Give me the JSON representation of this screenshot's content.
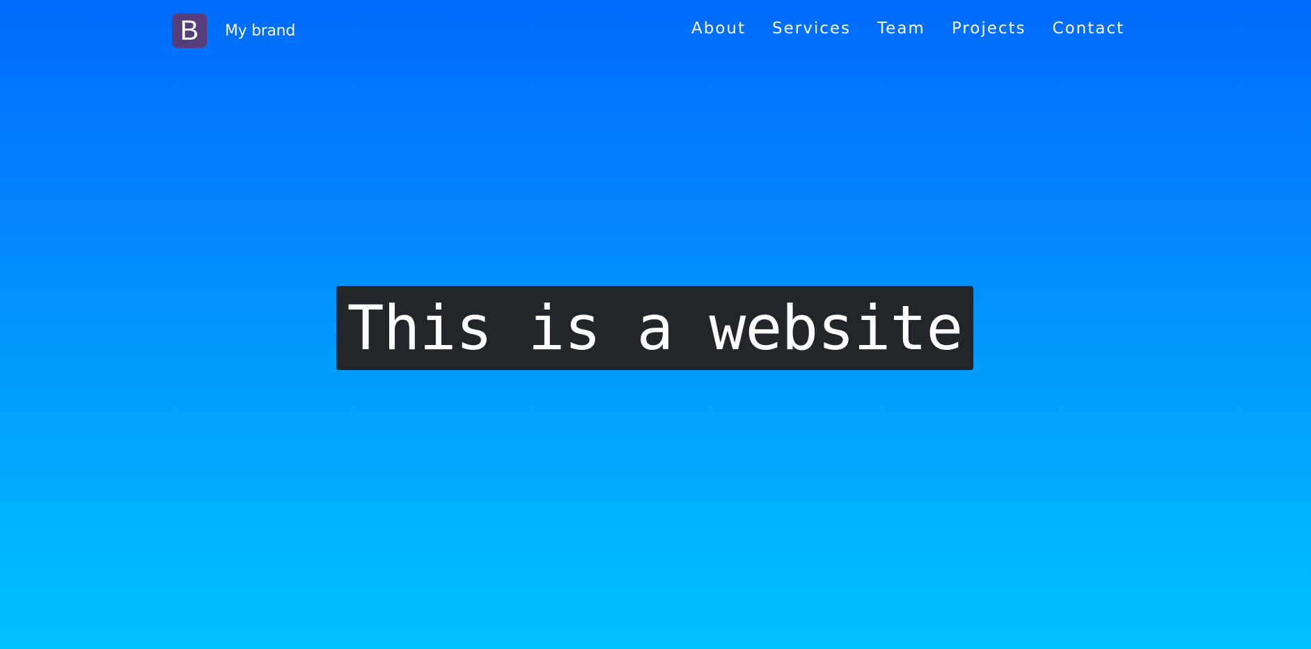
{
  "brand": {
    "logo_letter": "B",
    "name": "My brand"
  },
  "nav": {
    "items": [
      {
        "label": "About"
      },
      {
        "label": "Services"
      },
      {
        "label": "Team"
      },
      {
        "label": "Projects"
      },
      {
        "label": "Contact"
      }
    ]
  },
  "hero": {
    "title": "This is a website"
  },
  "colors": {
    "background_top": "#016aff",
    "background_bottom": "#00c2ff",
    "brand_logo_bg": "#563d7c",
    "hero_bg": "#222529",
    "text": "#ffffff"
  }
}
